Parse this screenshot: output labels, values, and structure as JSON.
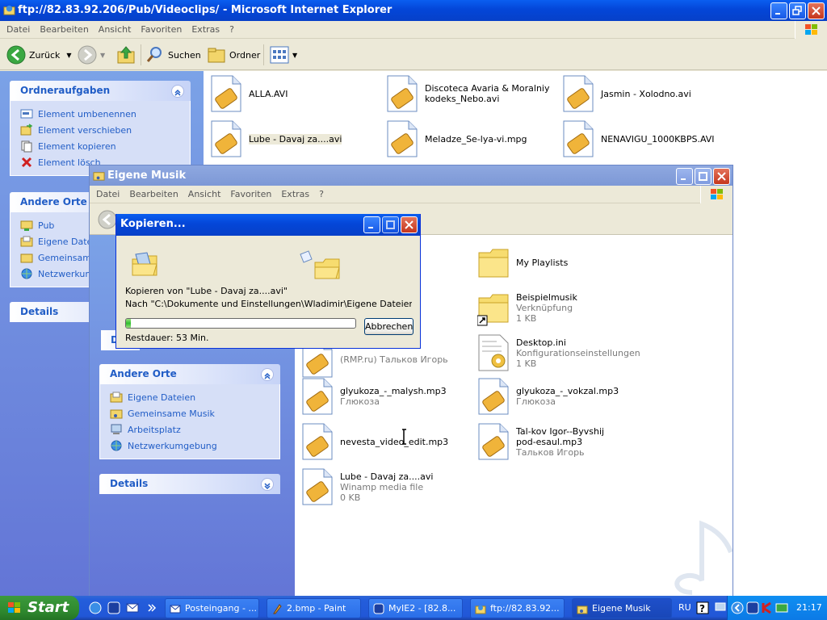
{
  "ftp_window": {
    "title": "ftp://82.83.92.206/Pub/Videoclips/ - Microsoft Internet Explorer",
    "menu": [
      "Datei",
      "Bearbeiten",
      "Ansicht",
      "Favoriten",
      "Extras",
      "?"
    ],
    "toolbar": {
      "back": "Zurück",
      "search": "Suchen",
      "folders": "Ordner"
    },
    "tasks_panel": {
      "title": "Ordneraufgaben",
      "items": [
        "Element umbenennen",
        "Element verschieben",
        "Element kopieren",
        "Element lösch"
      ]
    },
    "places_panel": {
      "title": "Andere Orte",
      "items": [
        "Pub",
        "Eigene Datei",
        "Gemeinsame",
        "Netzwerkum"
      ]
    },
    "details_panel": {
      "title": "Details"
    },
    "files": [
      "ALLA.AVI",
      "Discoteca Avaria & Moralniy kodeks_Nebo.avi",
      "Jasmin - Xolodno.avi",
      "Lube - Davaj za....avi",
      "Meladze_Se-lya-vi.mpg",
      "NENAVIGU_1000KBPS.AVI"
    ]
  },
  "music_window": {
    "title": "Eigene Musik",
    "menu": [
      "Datei",
      "Bearbeiten",
      "Ansicht",
      "Favoriten",
      "Extras",
      "?"
    ],
    "side_panel_partial": "De",
    "places_panel": {
      "title": "Andere Orte",
      "items": [
        "Eigene Dateien",
        "Gemeinsame Musik",
        "Arbeitsplatz",
        "Netzwerkumgebung"
      ]
    },
    "details_panel": {
      "title": "Details"
    },
    "folders": [
      {
        "name": "My Playlists"
      },
      {
        "name": "Beispielmusik",
        "line2": "Verknüpfung",
        "line3": "1 KB"
      }
    ],
    "files": [
      {
        "name": "Desktop.ini",
        "line2": "Konfigurationseinstellungen",
        "line3": "1 KB"
      },
      {
        "name": "(RMP.ru) Тальков Игорь"
      },
      {
        "name": "glyukoza_-_malysh.mp3",
        "line2": "Глюкоза"
      },
      {
        "name": "glyukoza_-_vokzal.mp3",
        "line2": "Глюкоза"
      },
      {
        "name": "nevesta_video_edit.mp3"
      },
      {
        "name": "Tal-kov Igor--Byvshij pod-esaul.mp3",
        "line2": "Тальков Игорь"
      },
      {
        "name": "Lube - Davaj za....avi",
        "line2": "Winamp media file",
        "line3": "0 KB"
      }
    ]
  },
  "copy_dialog": {
    "title": "Kopieren...",
    "from_text": "Kopieren von \"Lube - Davaj za....avi\"",
    "to_text": "Nach \"C:\\Dokumente und Einstellungen\\Wladimir\\Eigene Dateien\\Eigene",
    "progress_fraction": 0.02,
    "remaining": "Restdauer: 53 Min.",
    "cancel": "Abbrechen"
  },
  "taskbar": {
    "start": "Start",
    "tasks": [
      "Posteingang - ...",
      "2.bmp - Paint",
      "MyIE2 - [82.8...",
      "ftp://82.83.92...",
      "Eigene Musik"
    ],
    "lang": "RU",
    "clock": "21:17"
  },
  "colors": {
    "titlebar": "#0a5ef0",
    "sidebar": "#7ba2e7",
    "link": "#215dc6",
    "taskbar": "#245edb",
    "start": "#3c9a3c"
  }
}
